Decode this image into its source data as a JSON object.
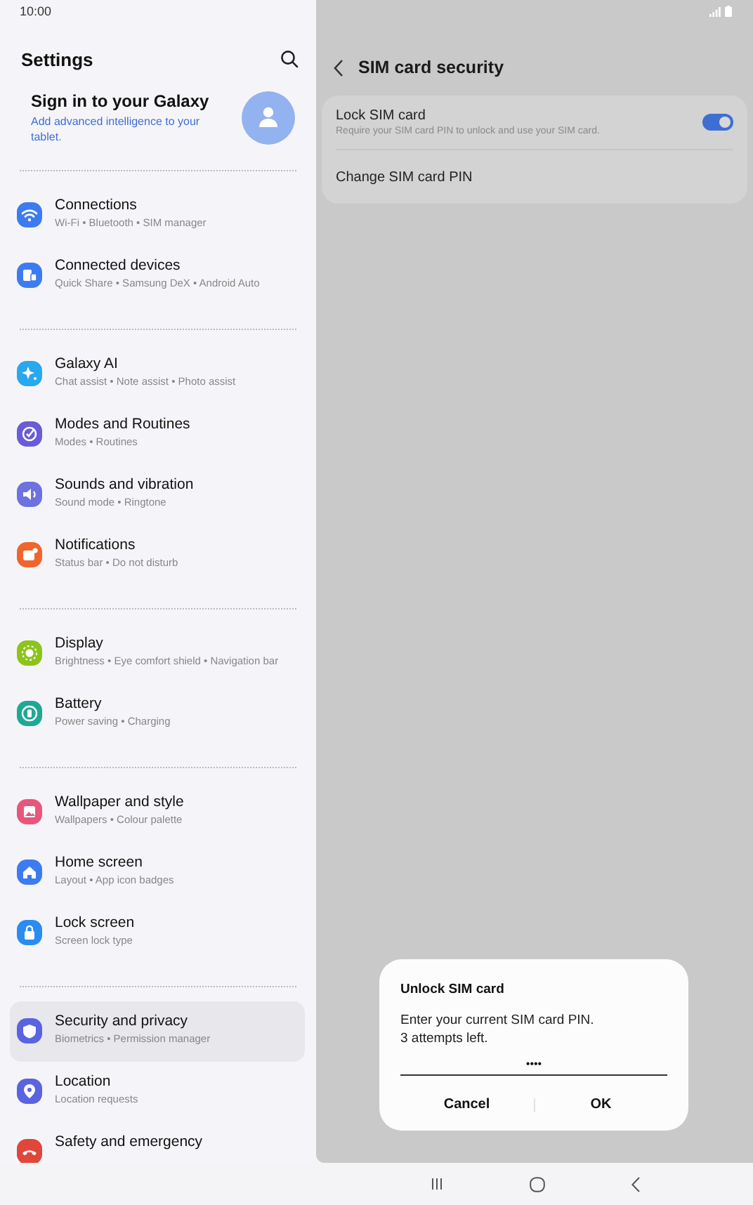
{
  "status_bar": {
    "time": "10:00"
  },
  "settings": {
    "title": "Settings",
    "profile": {
      "title": "Sign in to your Galaxy",
      "subtitle": "Add advanced intelligence to your tablet."
    },
    "groups": [
      {
        "items": [
          {
            "title": "Connections",
            "subtitle": "Wi-Fi  •  Bluetooth  •  SIM manager",
            "color": "#3d7cf0",
            "selected": false
          },
          {
            "title": "Connected devices",
            "subtitle": "Quick Share  •  Samsung DeX  •  Android Auto",
            "color": "#3d7cf0",
            "selected": false
          }
        ]
      },
      {
        "items": [
          {
            "title": "Galaxy AI",
            "subtitle": "Chat assist  •  Note assist  •  Photo assist",
            "color": "#28a8ef",
            "selected": false
          },
          {
            "title": "Modes and Routines",
            "subtitle": "Modes  •  Routines",
            "color": "#6a5bd8",
            "selected": false
          },
          {
            "title": "Sounds and vibration",
            "subtitle": "Sound mode  •  Ringtone",
            "color": "#6c72e0",
            "selected": false
          },
          {
            "title": "Notifications",
            "subtitle": "Status bar  •  Do not disturb",
            "color": "#f0652d",
            "selected": false
          }
        ]
      },
      {
        "items": [
          {
            "title": "Display",
            "subtitle": "Brightness  •  Eye comfort shield  •  Navigation bar",
            "color": "#8cc41c",
            "selected": false
          },
          {
            "title": "Battery",
            "subtitle": "Power saving  •  Charging",
            "color": "#1fa894",
            "selected": false
          }
        ]
      },
      {
        "items": [
          {
            "title": "Wallpaper and style",
            "subtitle": "Wallpapers  •  Colour palette",
            "color": "#e8577a",
            "selected": false
          },
          {
            "title": "Home screen",
            "subtitle": "Layout  •  App icon badges",
            "color": "#3d7cf0",
            "selected": false
          },
          {
            "title": "Lock screen",
            "subtitle": "Screen lock type",
            "color": "#2a8cf0",
            "selected": false
          }
        ]
      },
      {
        "items": [
          {
            "title": "Security and privacy",
            "subtitle": "Biometrics  •  Permission manager",
            "color": "#5a63e0",
            "selected": true
          },
          {
            "title": "Location",
            "subtitle": "Location requests",
            "color": "#5a63e0",
            "selected": false
          },
          {
            "title": "Safety and emergency",
            "color": "#e0463a",
            "selected": false
          }
        ]
      }
    ]
  },
  "sim_security": {
    "title": "SIM card security",
    "items": [
      {
        "kind": "toggle",
        "title": "Lock SIM card",
        "subtitle": "Require your SIM card PIN to unlock and use your SIM card.",
        "on": true
      },
      {
        "kind": "link",
        "title": "Change SIM card PIN"
      }
    ]
  },
  "dialog": {
    "title": "Unlock SIM card",
    "message": [
      "Enter your current SIM card PIN.",
      "3 attempts left."
    ],
    "pin_value": "••••",
    "buttons": [
      "Cancel",
      "OK"
    ]
  }
}
